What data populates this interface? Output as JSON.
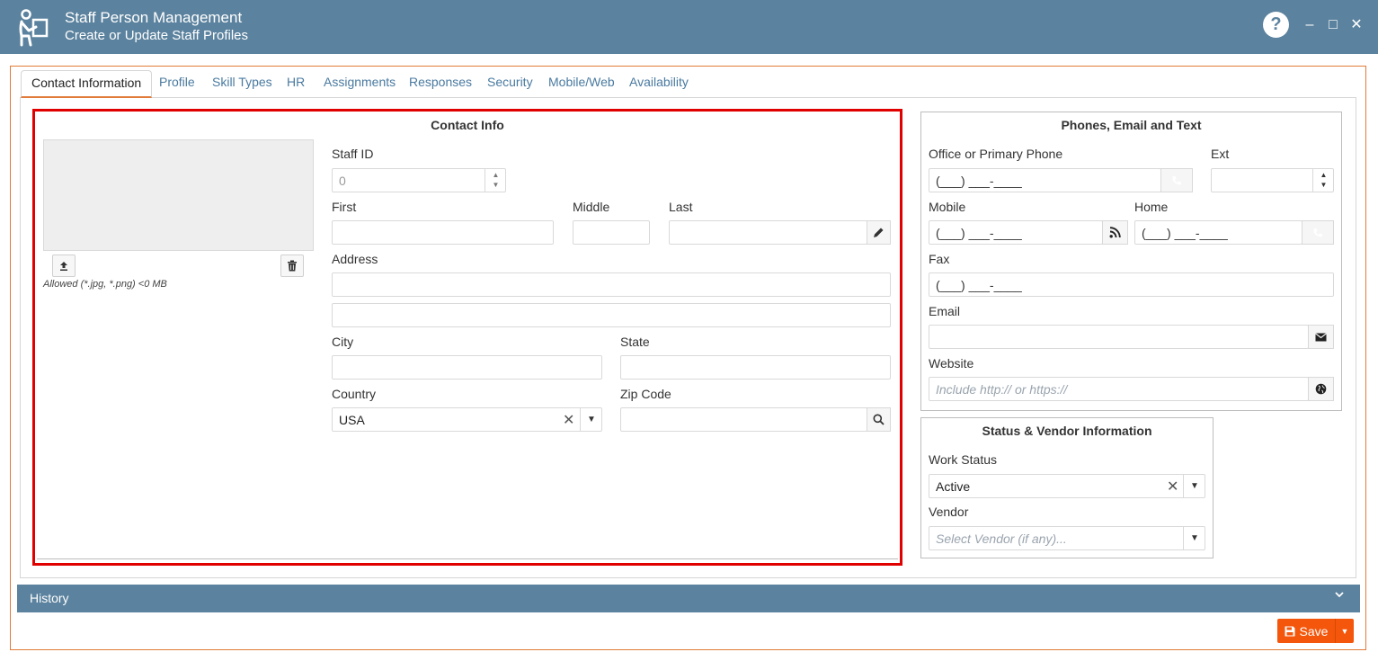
{
  "header": {
    "title": "Staff Person Management",
    "subtitle": "Create or Update Staff Profiles",
    "help_label": "?",
    "minimize_label": "–",
    "maximize_label": "□",
    "close_label": "✕"
  },
  "tabs": [
    {
      "label": "Contact Information",
      "active": true
    },
    {
      "label": "Profile"
    },
    {
      "label": "Skill Types"
    },
    {
      "label": "HR"
    },
    {
      "label": "Assignments"
    },
    {
      "label": "Responses"
    },
    {
      "label": "Security"
    },
    {
      "label": "Mobile/Web"
    },
    {
      "label": "Availability"
    }
  ],
  "contact_info": {
    "title": "Contact Info",
    "photo_note": "Allowed (*.jpg, *.png) <0 MB",
    "staff_id_label": "Staff ID",
    "staff_id_value": "0",
    "first_label": "First",
    "middle_label": "Middle",
    "last_label": "Last",
    "address_label": "Address",
    "city_label": "City",
    "state_label": "State",
    "country_label": "Country",
    "country_value": "USA",
    "zip_label": "Zip Code"
  },
  "phones": {
    "title": "Phones, Email and Text",
    "office_label": "Office or Primary Phone",
    "office_value": "(___) ___-____",
    "ext_label": "Ext",
    "mobile_label": "Mobile",
    "mobile_value": "(___) ___-____",
    "home_label": "Home",
    "home_value": "(___) ___-____",
    "fax_label": "Fax",
    "fax_value": "(___) ___-____",
    "email_label": "Email",
    "website_label": "Website",
    "website_placeholder": "Include http:// or https://"
  },
  "status": {
    "title": "Status & Vendor Information",
    "work_status_label": "Work Status",
    "work_status_value": "Active",
    "vendor_label": "Vendor",
    "vendor_placeholder": "Select Vendor (if any)..."
  },
  "history": {
    "label": "History"
  },
  "save": {
    "label": "Save"
  },
  "colors": {
    "header": "#5b829e",
    "accent": "#f4560b",
    "highlight": "#e00000"
  }
}
